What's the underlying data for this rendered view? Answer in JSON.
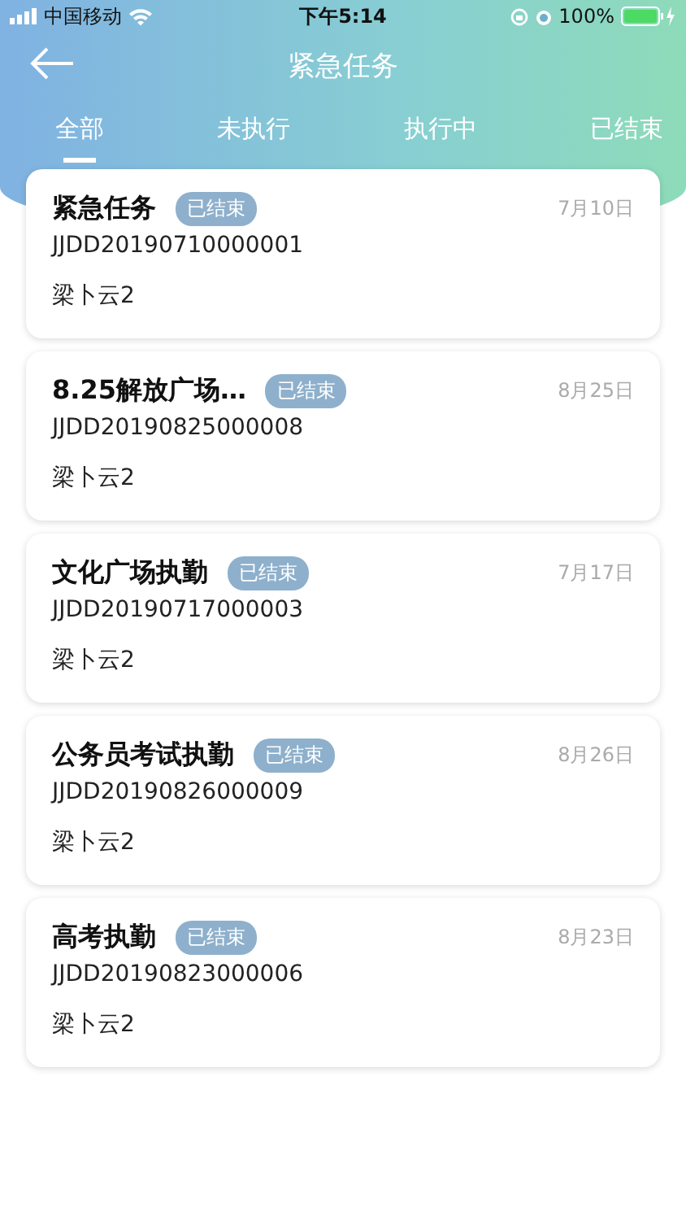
{
  "status_bar": {
    "carrier": "中国移动",
    "time": "下午5:14",
    "battery": "100%"
  },
  "header": {
    "title": "紧急任务"
  },
  "tabs": [
    {
      "label": "全部",
      "selected": true
    },
    {
      "label": "未执行",
      "selected": false
    },
    {
      "label": "执行中",
      "selected": false
    },
    {
      "label": "已结束",
      "selected": false
    }
  ],
  "tasks": [
    {
      "title": "紧急任务",
      "status": "已结束",
      "date": "7月10日",
      "code": "JJDD20190710000001",
      "person": "梁卜云2"
    },
    {
      "title": "8.25解放广场…",
      "status": "已结束",
      "date": "8月25日",
      "code": "JJDD20190825000008",
      "person": "梁卜云2"
    },
    {
      "title": "文化广场执勤",
      "status": "已结束",
      "date": "7月17日",
      "code": "JJDD20190717000003",
      "person": "梁卜云2"
    },
    {
      "title": "公务员考试执勤",
      "status": "已结束",
      "date": "8月26日",
      "code": "JJDD20190826000009",
      "person": "梁卜云2"
    },
    {
      "title": "高考执勤",
      "status": "已结束",
      "date": "8月23日",
      "code": "JJDD20190823000006",
      "person": "梁卜云2"
    }
  ]
}
